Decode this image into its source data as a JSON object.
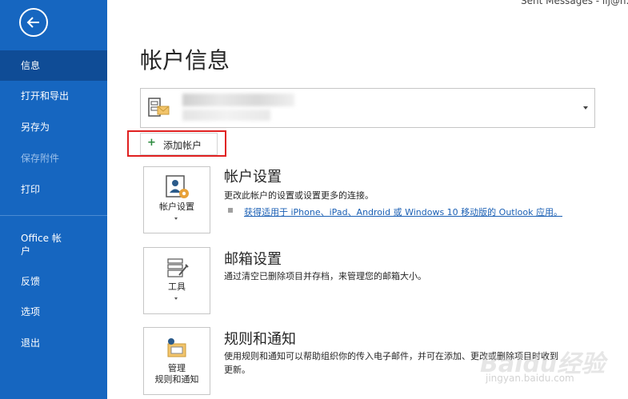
{
  "topbar": {
    "title": "Sent Messages - lij@h..."
  },
  "sidebar": {
    "items": [
      {
        "label": "信息"
      },
      {
        "label": "打开和导出"
      },
      {
        "label": "另存为"
      },
      {
        "label": "保存附件"
      },
      {
        "label": "打印"
      },
      {
        "label": "Office 帐\n户"
      },
      {
        "label": "反馈"
      },
      {
        "label": "选项"
      },
      {
        "label": "退出"
      }
    ]
  },
  "main": {
    "title": "帐户信息",
    "add_account_label": "添加帐户",
    "sections": [
      {
        "card_label": "帐户设置",
        "title": "帐户设置",
        "desc": "更改此帐户的设置或设置更多的连接。",
        "link": "获得适用于 iPhone、iPad、Android 或 Windows 10 移动版的 Outlook 应用。"
      },
      {
        "card_label": "工具",
        "title": "邮箱设置",
        "desc": "通过清空已删除项目并存档，来管理您的邮箱大小。"
      },
      {
        "card_label": "管理\n规则和通知",
        "title": "规则和通知",
        "desc": "使用规则和通知可以帮助组织你的传入电子邮件，并可在添加、更改或删除项目时收到",
        "desc2": "更新。"
      }
    ]
  },
  "watermark": {
    "text": "Baidu经验",
    "sub": "jingyan.baidu.com"
  }
}
